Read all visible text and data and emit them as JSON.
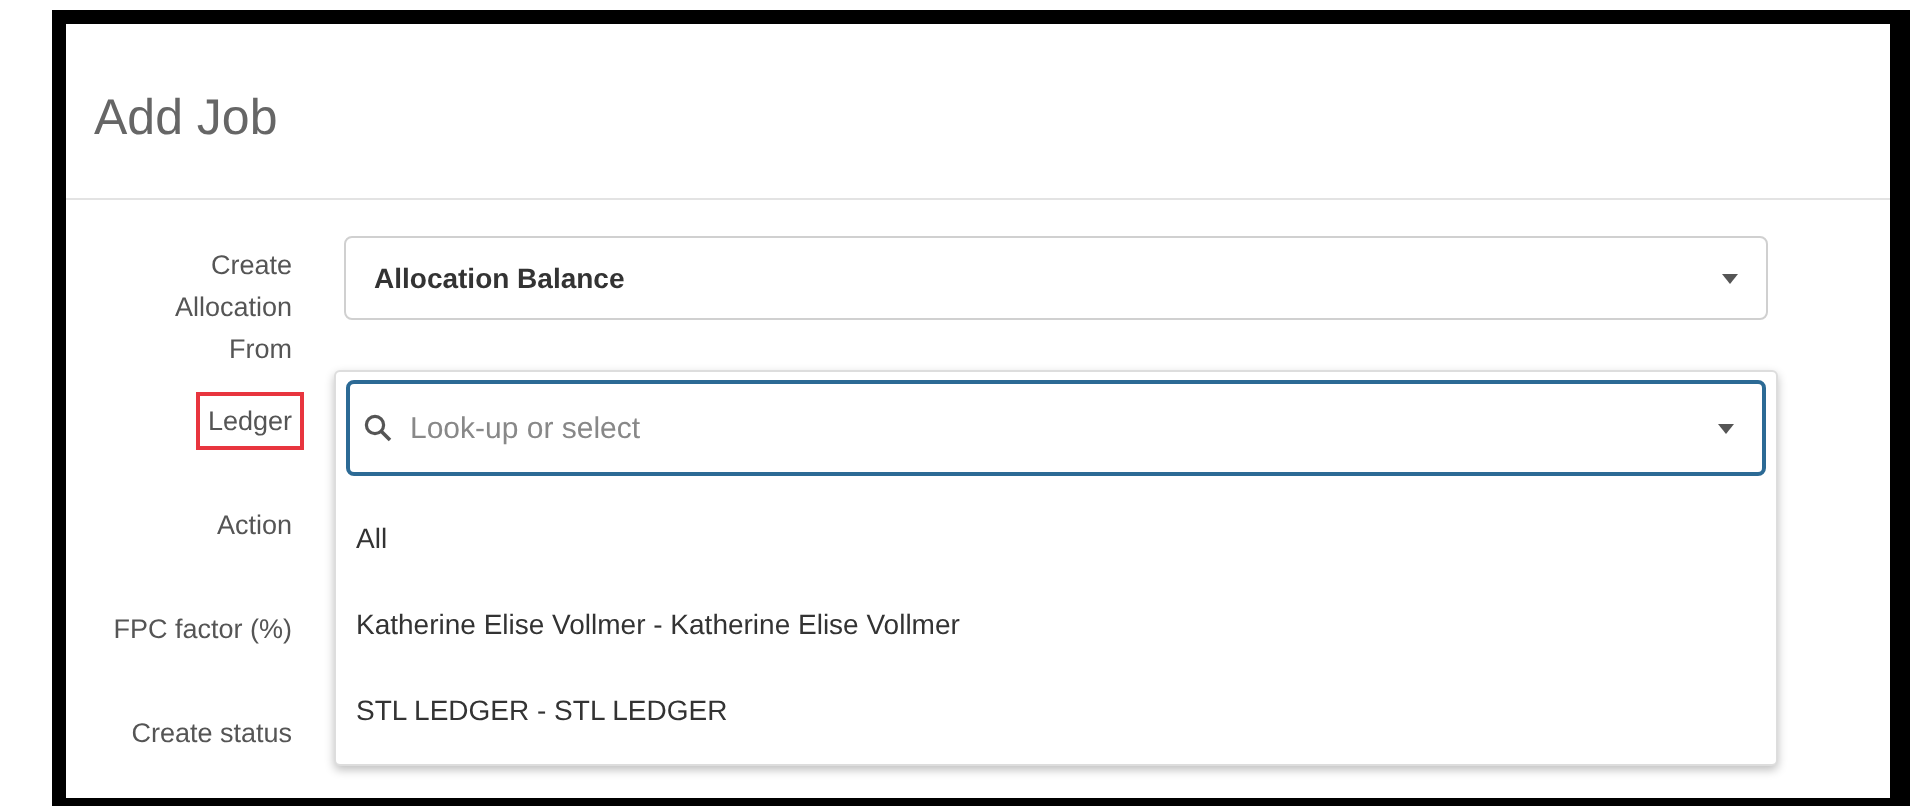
{
  "dialog": {
    "title": "Add Job"
  },
  "fields": [
    {
      "label": "Create Allocation From",
      "kind": "select",
      "value": "Allocation Balance",
      "highlighted": false
    },
    {
      "label": "Ledger",
      "kind": "lookup",
      "placeholder": "Look-up or select",
      "highlighted": true,
      "expanded": true,
      "options": [
        "All",
        "Katherine Elise Vollmer - Katherine Elise Vollmer",
        "STL LEDGER - STL LEDGER"
      ]
    },
    {
      "label": "Action",
      "kind": "covered",
      "highlighted": false
    },
    {
      "label": "FPC factor (%)",
      "kind": "covered",
      "highlighted": false
    },
    {
      "label": "Create status",
      "kind": "covered",
      "highlighted": false
    }
  ]
}
